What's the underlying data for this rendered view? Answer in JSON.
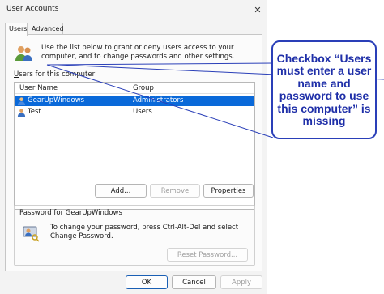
{
  "window": {
    "title": "User Accounts",
    "close_glyph": "✕"
  },
  "tabs": [
    {
      "label": "Users",
      "active": true
    },
    {
      "label": "Advanced",
      "active": false
    }
  ],
  "intro": {
    "icon": "users-icon",
    "text": "Use the list below to grant or deny users access to your computer, and to change passwords and other settings."
  },
  "user_list": {
    "label_prefix": "",
    "label_mnemonic": "U",
    "label_rest": "sers for this computer:",
    "columns": [
      "User Name",
      "Group"
    ],
    "rows": [
      {
        "name": "GearUpWindows",
        "group": "Administrators",
        "selected": true
      },
      {
        "name": "Test",
        "group": "Users",
        "selected": false
      }
    ]
  },
  "buttons": {
    "add": "Add...",
    "remove": "Remove",
    "properties": "Properties",
    "reset_password": "Reset Password...",
    "ok": "OK",
    "cancel": "Cancel",
    "apply": "Apply"
  },
  "password_group": {
    "label": "Password for GearUpWindows",
    "icon": "key-user-icon",
    "text": "To change your password, press Ctrl-Alt-Del and select Change Password."
  },
  "callout": {
    "text": "Checkbox “Users must enter a user name and password to use this computer” is missing",
    "color": "#1f2fa8"
  },
  "colors": {
    "selection": "#0a69d9",
    "callout_border": "#2a3fb8"
  }
}
